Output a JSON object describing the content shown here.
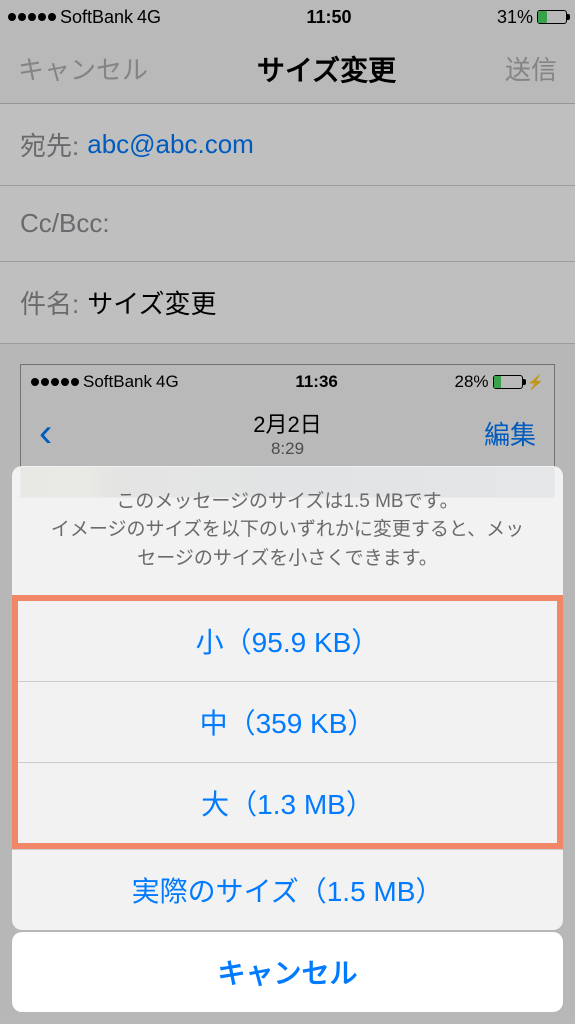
{
  "statusBar": {
    "carrier": "SoftBank",
    "network": "4G",
    "time": "11:50",
    "battery": "31%",
    "batteryWidth": "31%"
  },
  "nav": {
    "cancel": "キャンセル",
    "title": "サイズ変更",
    "send": "送信"
  },
  "compose": {
    "toLabel": "宛先:",
    "toValue": "abc@abc.com",
    "ccLabel": "Cc/Bcc:",
    "subjectLabel": "件名:",
    "subjectValue": "サイズ変更"
  },
  "attachment": {
    "carrier": "SoftBank",
    "network": "4G",
    "time": "11:36",
    "battery": "28%",
    "batteryWidth": "28%",
    "date": "2月2日",
    "subtime": "8:29",
    "edit": "編集"
  },
  "sheet": {
    "message": "このメッセージのサイズは1.5 MBです。\nイメージのサイズを以下のいずれかに変更すると、メッセージのサイズを小さくできます。",
    "small": "小（95.9 KB）",
    "medium": "中（359 KB）",
    "large": "大（1.3 MB）",
    "actual": "実際のサイズ（1.5 MB）",
    "cancel": "キャンセル"
  }
}
